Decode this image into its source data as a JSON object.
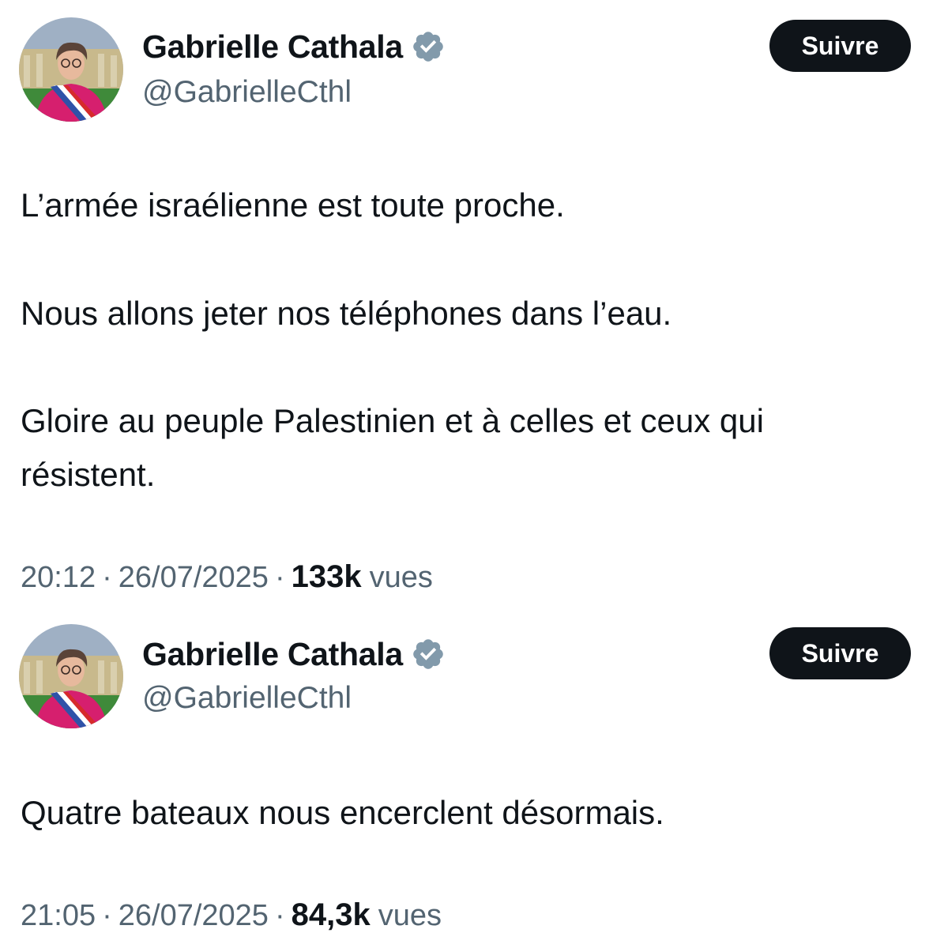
{
  "tweets": [
    {
      "author": {
        "display_name": "Gabrielle Cathala",
        "handle": "@GabrielleCthl",
        "verified_icon": "verified-badge-icon"
      },
      "follow_label": "Suivre",
      "text": {
        "paragraph_1": "L’armée israélienne est toute proche.",
        "paragraph_2": "Nous allons jeter nos téléphones dans l’eau.",
        "paragraph_3_line_1": "Gloire au peuple Palestinien et à  celles et ceux qui",
        "paragraph_3_line_2": "résistent."
      },
      "meta": {
        "time": "20:12",
        "separator": "·",
        "date": "26/07/2025",
        "views_count": "133k",
        "views_label": "vues"
      }
    },
    {
      "author": {
        "display_name": "Gabrielle Cathala",
        "handle": "@GabrielleCthl",
        "verified_icon": "verified-badge-icon"
      },
      "follow_label": "Suivre",
      "text": {
        "paragraph_1": "Quatre bateaux nous encerclent désormais."
      },
      "meta": {
        "time": "21:05",
        "separator": "·",
        "date": "26/07/2025",
        "views_count": "84,3k",
        "views_label": "vues"
      }
    }
  ],
  "colors": {
    "text_primary": "#0f1419",
    "text_secondary": "#536471",
    "button_bg": "#0f1419",
    "button_text": "#ffffff",
    "verified_badge": "#829aab"
  }
}
